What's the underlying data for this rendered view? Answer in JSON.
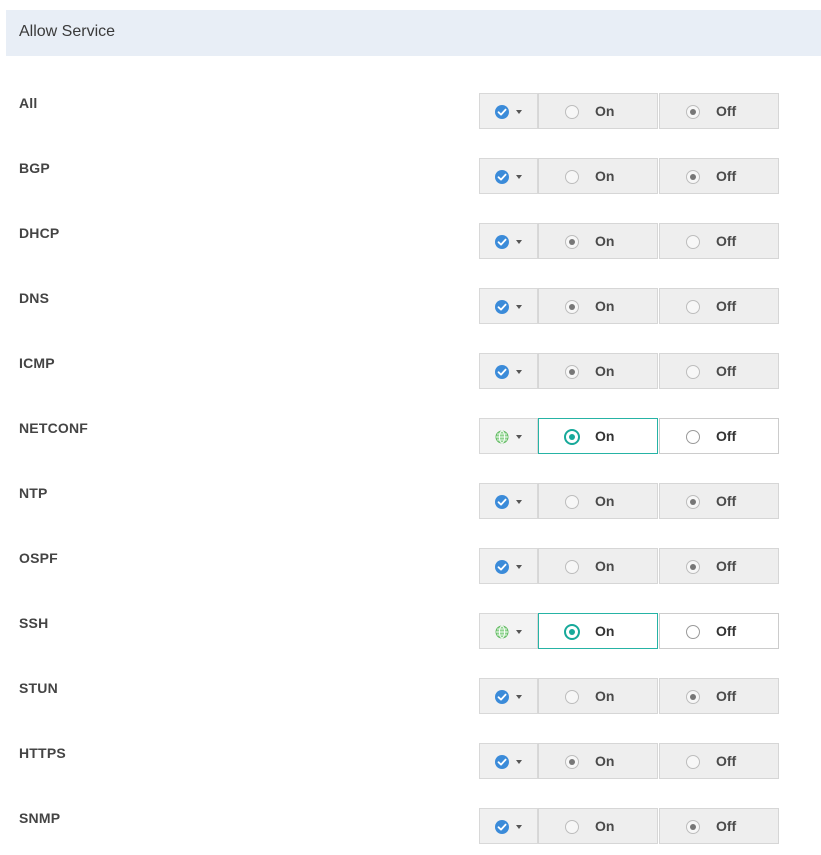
{
  "section": {
    "title": "Allow Service"
  },
  "option_labels": {
    "on": "On",
    "off": "Off"
  },
  "colors": {
    "inherited_icon": "#3b8bd9",
    "local_icon": "#6cc36c",
    "selected_border": "#26b3a5"
  },
  "services": [
    {
      "name": "All",
      "scope_icon": "check-circle-icon",
      "value": "Off",
      "editable": false
    },
    {
      "name": "BGP",
      "scope_icon": "check-circle-icon",
      "value": "Off",
      "editable": false
    },
    {
      "name": "DHCP",
      "scope_icon": "check-circle-icon",
      "value": "On",
      "editable": false
    },
    {
      "name": "DNS",
      "scope_icon": "check-circle-icon",
      "value": "On",
      "editable": false
    },
    {
      "name": "ICMP",
      "scope_icon": "check-circle-icon",
      "value": "On",
      "editable": false
    },
    {
      "name": "NETCONF",
      "scope_icon": "globe-icon",
      "value": "On",
      "editable": true
    },
    {
      "name": "NTP",
      "scope_icon": "check-circle-icon",
      "value": "Off",
      "editable": false
    },
    {
      "name": "OSPF",
      "scope_icon": "check-circle-icon",
      "value": "Off",
      "editable": false
    },
    {
      "name": "SSH",
      "scope_icon": "globe-icon",
      "value": "On",
      "editable": true
    },
    {
      "name": "STUN",
      "scope_icon": "check-circle-icon",
      "value": "Off",
      "editable": false
    },
    {
      "name": "HTTPS",
      "scope_icon": "check-circle-icon",
      "value": "On",
      "editable": false
    },
    {
      "name": "SNMP",
      "scope_icon": "check-circle-icon",
      "value": "Off",
      "editable": false
    }
  ]
}
